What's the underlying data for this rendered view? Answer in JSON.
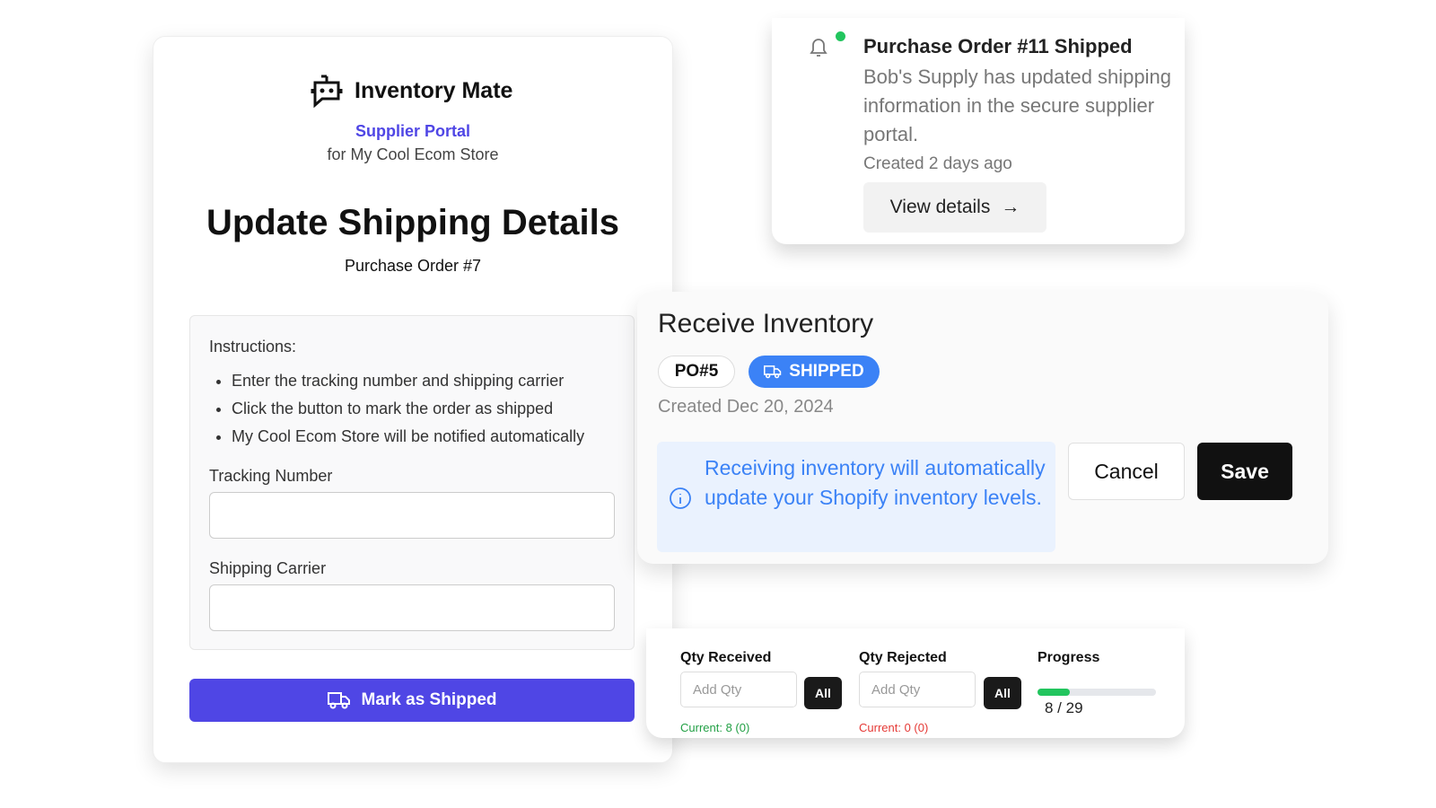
{
  "brand": {
    "name": "Inventory Mate",
    "portal": "Supplier Portal",
    "store": "for My Cool Ecom Store"
  },
  "shipping": {
    "title": "Update Shipping Details",
    "po": "Purchase Order #7",
    "instructions_label": "Instructions:",
    "instructions": [
      "Enter the tracking number and shipping carrier",
      "Click the button to mark the order as shipped",
      "My Cool Ecom Store will be notified automatically"
    ],
    "tracking_label": "Tracking Number",
    "tracking_value": "",
    "carrier_label": "Shipping Carrier",
    "carrier_value": "",
    "button": "Mark as Shipped"
  },
  "notification": {
    "title": "Purchase Order #11 Shipped",
    "body": "Bob's Supply has updated shipping information in the secure supplier portal.",
    "created": "Created 2 days ago",
    "button": "View details",
    "dot_color": "#22c55e"
  },
  "receive": {
    "title": "Receive Inventory",
    "po": "PO#5",
    "status": "SHIPPED",
    "status_color": "#3b82f6",
    "created": "Created Dec 20, 2024",
    "info": "Receiving inventory will automatically update your Shopify inventory levels.",
    "cancel": "Cancel",
    "save": "Save"
  },
  "qty": {
    "received_label": "Qty Received",
    "rejected_label": "Qty Rejected",
    "progress_label": "Progress",
    "placeholder": "Add Qty",
    "all": "All",
    "received_current": "Current: 8 (0)",
    "rejected_current": "Current: 0 (0)",
    "progress_text": "8 / 29",
    "progress_value": 8,
    "progress_total": 29
  }
}
